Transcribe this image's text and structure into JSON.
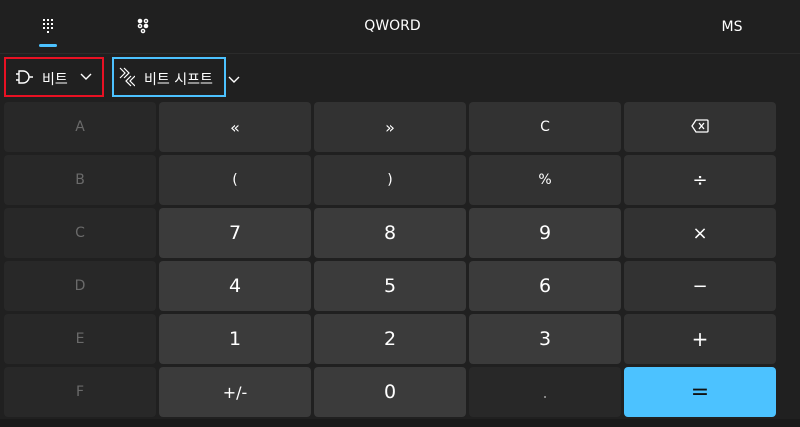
{
  "header": {
    "word_size": "QWORD",
    "memory_button": "MS"
  },
  "toolbar": {
    "bitwise_label": "비트",
    "bitshift_label": "비트 시프트"
  },
  "keypad": {
    "hex": [
      "A",
      "B",
      "C",
      "D",
      "E",
      "F"
    ],
    "row1": [
      "«",
      "»",
      "C"
    ],
    "row2": [
      "(",
      ")",
      "%",
      "÷"
    ],
    "row3": [
      "7",
      "8",
      "9",
      "×"
    ],
    "row4": [
      "4",
      "5",
      "6",
      "−"
    ],
    "row5": [
      "1",
      "2",
      "3",
      "+"
    ],
    "row6": [
      "+/-",
      "0",
      ".",
      "="
    ]
  },
  "colors": {
    "accent": "#4cc2ff",
    "highlight_red": "#e81123",
    "background": "#202020"
  }
}
